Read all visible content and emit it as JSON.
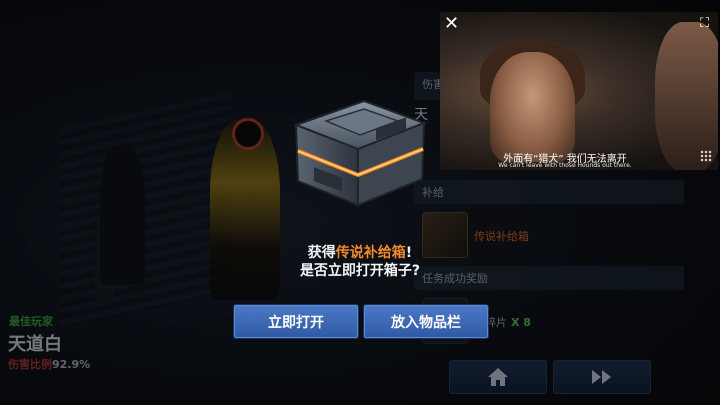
{
  "background": {
    "right_panel": {
      "damage_header": "伤害",
      "title_partial": "天",
      "supply_header": "补给",
      "supply_item_name": "传说补给箱",
      "reward_header": "任务成功奖励",
      "shard_label": "元碎片",
      "shard_count": "X 8"
    },
    "mvp": {
      "tag": "最佳玩家",
      "name": "天道白",
      "damage_label": "伤害比例",
      "damage_value": "92.9%"
    },
    "nav": {
      "home_icon": "home-icon",
      "skip_icon": "fast-forward-icon"
    }
  },
  "video": {
    "close_icon": "close-icon",
    "expand_icon": "expand-icon",
    "subtitle_cn": "外面有“猎犬” 我们无法离开",
    "subtitle_en": "We can't leave with those Hounds out there."
  },
  "dialog": {
    "line1_prefix": "获得",
    "line1_highlight": "传说补给箱",
    "line1_suffix": "!",
    "line2": "是否立即打开箱子?",
    "open_button": "立即打开",
    "store_button": "放入物品栏",
    "highlight_color": "#f08a2d",
    "button_color": "#3c69b6"
  }
}
